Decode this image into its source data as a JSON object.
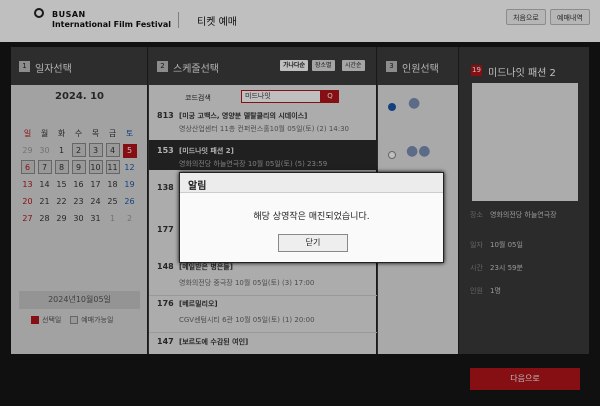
{
  "header": {
    "logo_line1": "BUSAN",
    "logo_line2": "International Film Festival",
    "title": "티켓 예매",
    "btn_first": "처음으로",
    "btn_history": "예매내역"
  },
  "steps": {
    "date": {
      "num": "1",
      "title": "일자선택"
    },
    "schedule": {
      "num": "2",
      "title": "스케줄선택"
    },
    "people": {
      "num": "3",
      "title": "인원선택"
    }
  },
  "sort": {
    "by_name": "가나다순",
    "by_place": "장소별",
    "by_time": "시간순"
  },
  "calendar": {
    "month": "2024. 10",
    "weekdays": [
      "일",
      "월",
      "화",
      "수",
      "목",
      "금",
      "토"
    ],
    "weeks": [
      [
        "29",
        "30",
        "1",
        "2",
        "3",
        "4",
        "5"
      ],
      [
        "6",
        "7",
        "8",
        "9",
        "10",
        "11",
        "12"
      ],
      [
        "13",
        "14",
        "15",
        "16",
        "17",
        "18",
        "19"
      ],
      [
        "20",
        "21",
        "22",
        "23",
        "24",
        "25",
        "26"
      ],
      [
        "27",
        "28",
        "29",
        "30",
        "31",
        "1",
        "2"
      ]
    ],
    "selected_date": "2024년10월05일",
    "legend_selected": "선택일",
    "legend_available": "예매가능일",
    "colors": {
      "accent": "#b3151b"
    }
  },
  "search": {
    "label": "코드검색",
    "value": "미드나잇",
    "button": "Q"
  },
  "movies": [
    {
      "code": "813",
      "title": "[미궁 고백스, 영양분 델탈클리의 시데이스]",
      "detail": "영상산업센터 11층 컨퍼런스홀10월 05일(토) (2) 14:30"
    },
    {
      "code": "153",
      "title": "[미드나잇 패션 2]",
      "detail": "영화의전당 하늘연극장     10월 05일(토) (5) 23:59"
    },
    {
      "code": "138",
      "title": "",
      "detail": ""
    },
    {
      "code": "177",
      "title": "",
      "detail": ""
    },
    {
      "code": "148",
      "title": "[메일받은 병은들]",
      "detail": "영화의전당 중극장          10월 05일(토) (3) 17:00"
    },
    {
      "code": "176",
      "title": "[베르밀리오]",
      "detail": "CGV센텀시티 6관            10월 05일(토) (1) 20:00"
    },
    {
      "code": "147",
      "title": "[보르도에 수감된 여인]",
      "detail": ""
    }
  ],
  "info": {
    "num": "19",
    "name": "미드나잇 패션 2",
    "labels": {
      "place": "장소",
      "date": "일자",
      "time": "시간",
      "people": "인원"
    },
    "values": {
      "place": "영화의전당 하늘연극장",
      "date": "10월 05일",
      "time": "23시 59분",
      "people": "1명"
    }
  },
  "next_button": "다음으로",
  "dialog": {
    "title": "알림",
    "message": "해당 상영작은 매진되었습니다.",
    "close": "닫기"
  }
}
